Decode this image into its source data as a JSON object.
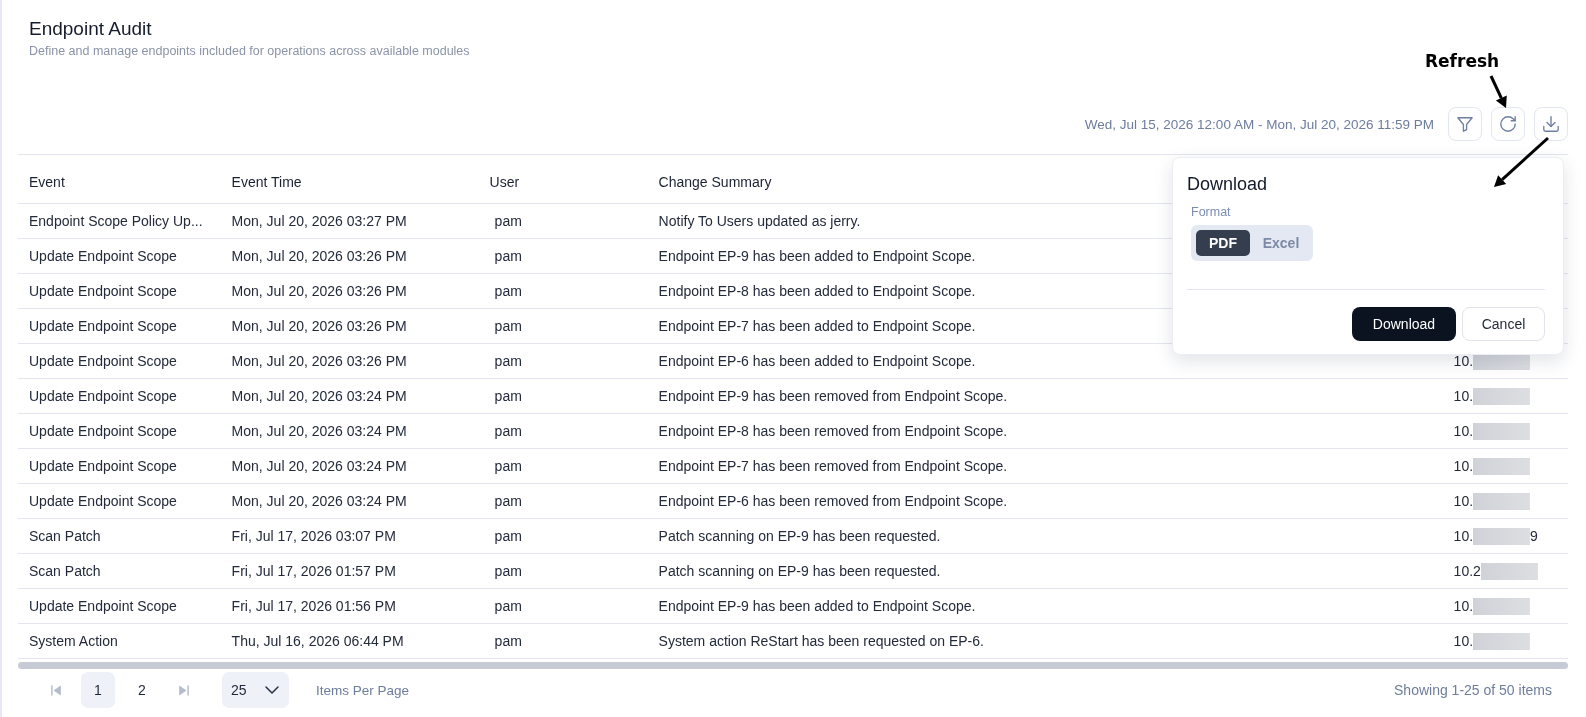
{
  "page": {
    "title": "Endpoint Audit",
    "subtitle": "Define and manage endpoints included for operations across available modules"
  },
  "annotation": {
    "label": "Refresh"
  },
  "toolbar": {
    "date_range": "Wed, Jul 15, 2026 12:00 AM - Mon, Jul 20, 2026 11:59 PM"
  },
  "table": {
    "columns": [
      "Event",
      "Event Time",
      "User",
      "Change Summary"
    ],
    "rows": [
      {
        "event": "Endpoint Scope Policy Up...",
        "event_time": "Mon, Jul 20, 2026 03:27 PM",
        "user": "pam",
        "change_summary": "Notify To Users updated as jerry."
      },
      {
        "event": "Update Endpoint Scope",
        "event_time": "Mon, Jul 20, 2026 03:26 PM",
        "user": "pam",
        "change_summary": "Endpoint EP-9 has been added to Endpoint Scope."
      },
      {
        "event": "Update Endpoint Scope",
        "event_time": "Mon, Jul 20, 2026 03:26 PM",
        "user": "pam",
        "change_summary": "Endpoint EP-8 has been added to Endpoint Scope."
      },
      {
        "event": "Update Endpoint Scope",
        "event_time": "Mon, Jul 20, 2026 03:26 PM",
        "user": "pam",
        "change_summary": "Endpoint EP-7 has been added to Endpoint Scope."
      },
      {
        "event": "Update Endpoint Scope",
        "event_time": "Mon, Jul 20, 2026 03:26 PM",
        "user": "pam",
        "change_summary": "Endpoint EP-6 has been added to Endpoint Scope.",
        "column_5": {
          "text": "10.",
          "redacted": true
        }
      },
      {
        "event": "Update Endpoint Scope",
        "event_time": "Mon, Jul 20, 2026 03:24 PM",
        "user": "pam",
        "change_summary": "Endpoint EP-9 has been removed from Endpoint Scope.",
        "column_5": {
          "text": "10.",
          "redacted": true
        }
      },
      {
        "event": "Update Endpoint Scope",
        "event_time": "Mon, Jul 20, 2026 03:24 PM",
        "user": "pam",
        "change_summary": "Endpoint EP-8 has been removed from Endpoint Scope.",
        "column_5": {
          "text": "10.",
          "redacted": true
        }
      },
      {
        "event": "Update Endpoint Scope",
        "event_time": "Mon, Jul 20, 2026 03:24 PM",
        "user": "pam",
        "change_summary": "Endpoint EP-7 has been removed from Endpoint Scope.",
        "column_5": {
          "text": "10.",
          "redacted": true
        }
      },
      {
        "event": "Update Endpoint Scope",
        "event_time": "Mon, Jul 20, 2026 03:24 PM",
        "user": "pam",
        "change_summary": "Endpoint EP-6 has been removed from Endpoint Scope.",
        "column_5": {
          "text": "10.",
          "redacted": true
        }
      },
      {
        "event": "Scan Patch",
        "event_time": "Fri, Jul 17, 2026 03:07 PM",
        "user": "pam",
        "change_summary": "Patch scanning on EP-9 has been requested.",
        "column_5": {
          "text": "10.",
          "redacted": true,
          "tail": "9"
        }
      },
      {
        "event": "Scan Patch",
        "event_time": "Fri, Jul 17, 2026 01:57 PM",
        "user": "pam",
        "change_summary": "Patch scanning on EP-9 has been requested.",
        "column_5": {
          "text": "10.2",
          "redacted": true
        }
      },
      {
        "event": "Update Endpoint Scope",
        "event_time": "Fri, Jul 17, 2026 01:56 PM",
        "user": "pam",
        "change_summary": "Endpoint EP-9 has been added to Endpoint Scope.",
        "column_5": {
          "text": "10.",
          "redacted": true
        }
      },
      {
        "event": "System Action",
        "event_time": "Thu, Jul 16, 2026 06:44 PM",
        "user": "pam",
        "change_summary": "System action ReStart has been requested on EP-6.",
        "column_5": {
          "text": "10.",
          "redacted": true
        }
      }
    ]
  },
  "download_popover": {
    "title": "Download",
    "format_label": "Format",
    "formats": [
      {
        "label": "PDF",
        "selected": true
      },
      {
        "label": "Excel",
        "selected": false
      }
    ],
    "buttons": [
      {
        "label": "Download",
        "kind": "primary"
      },
      {
        "label": "Cancel",
        "kind": "secondary"
      }
    ]
  },
  "pagination": {
    "pages": [
      {
        "label": "1",
        "selected": true
      },
      {
        "label": "2",
        "selected": false
      }
    ],
    "per_page": "25",
    "per_page_label": "Items Per Page",
    "summary": "Showing 1-25 of 50 items"
  }
}
